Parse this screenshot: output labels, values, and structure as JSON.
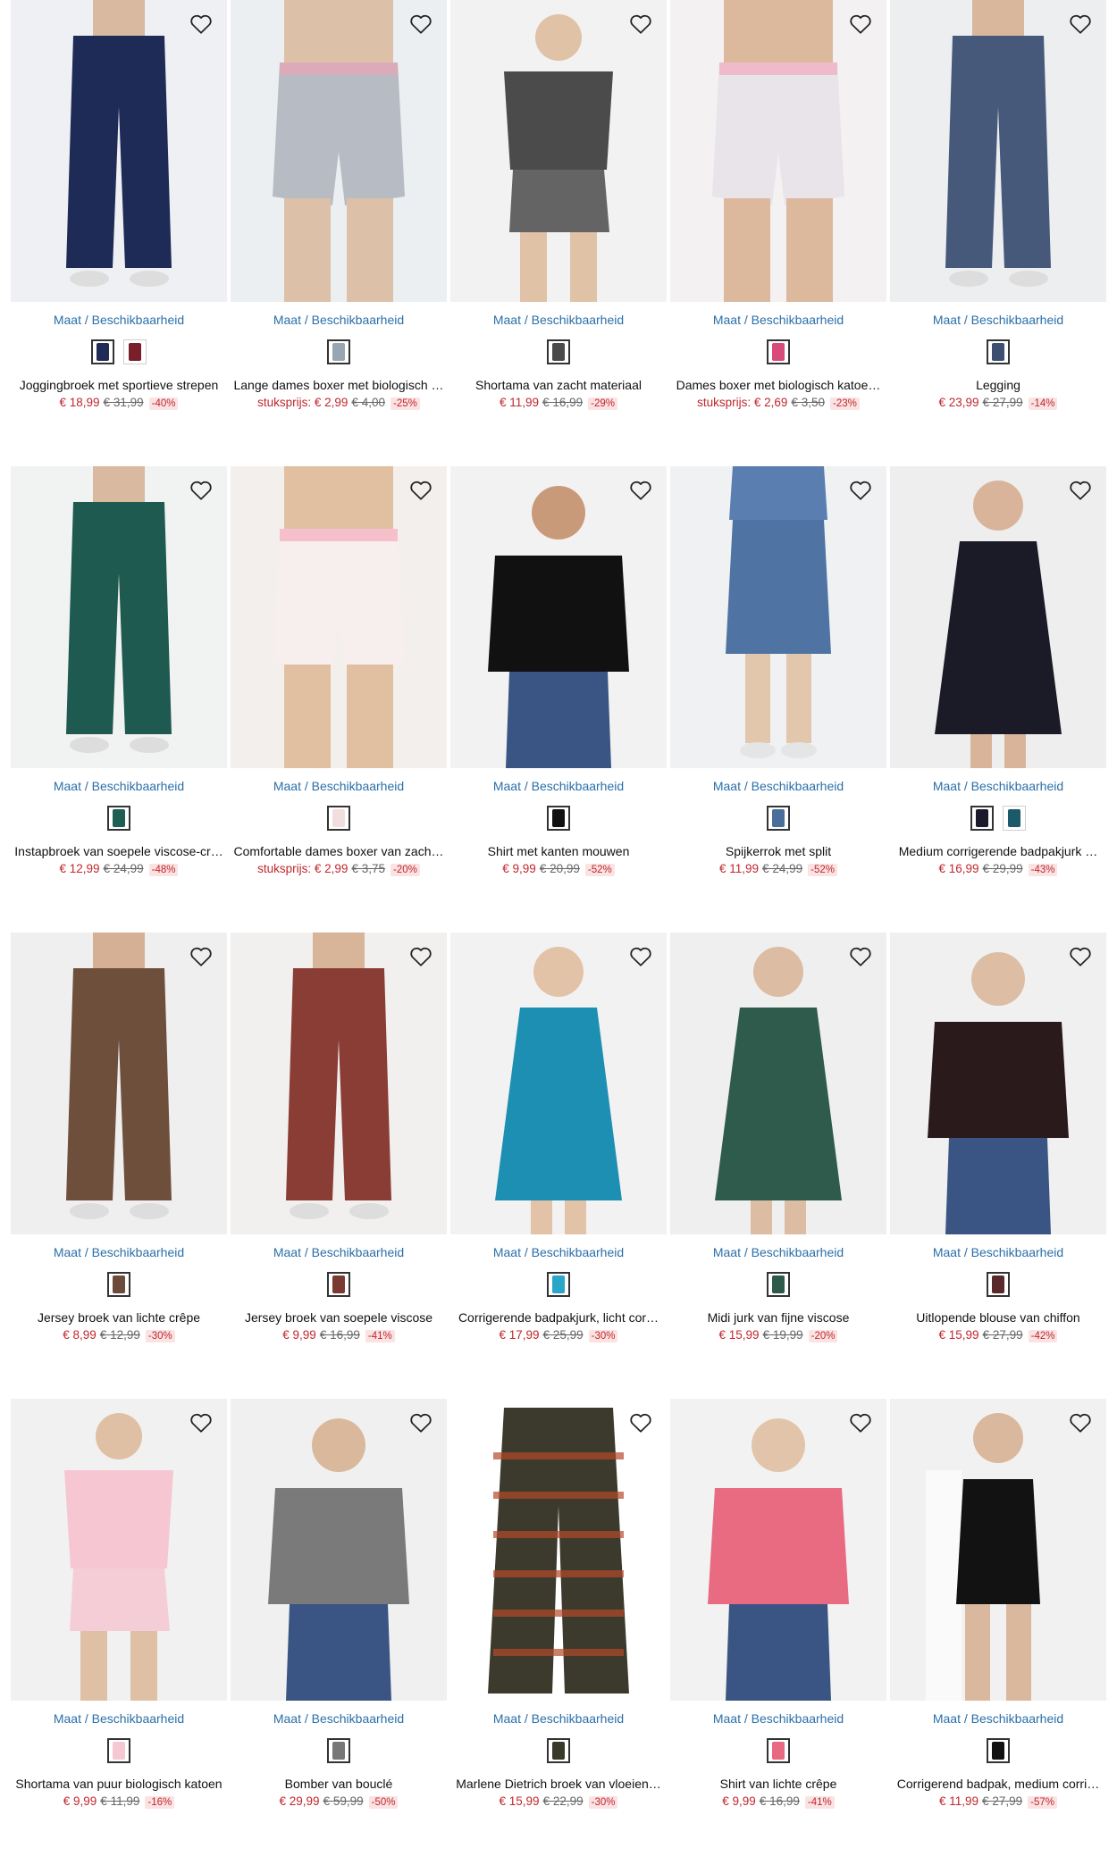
{
  "size_link_label": "Maat / Beschikbaarheid",
  "colors": {
    "price": "#c0272d",
    "link": "#2a6fa8",
    "discount_bg": "#fbe3e3"
  },
  "products": [
    {
      "title": "Joggingbroek met sportieve strepen",
      "price_prefix": "",
      "price": "€ 18,99",
      "old": "€ 31,99",
      "discount": "-40%",
      "icon": "heart-icon",
      "swatches": [
        "#1f2a55",
        "#7a1e2a"
      ],
      "img": {
        "bg": "#eef0f3",
        "garment": "#1e2b57",
        "type": "pants",
        "skin": "#d9b9a0"
      }
    },
    {
      "title": "Lange dames boxer met biologisch …",
      "price_prefix": "stuksprijs: ",
      "price": "€ 2,99",
      "old": "€ 4,00",
      "discount": "-25%",
      "swatches": [
        "#9aa5b4"
      ],
      "img": {
        "bg": "#eceff1",
        "garment": "#b7bcc4",
        "type": "shorts",
        "skin": "#dcc0a8"
      }
    },
    {
      "title": "Shortama van zacht materiaal",
      "price_prefix": "",
      "price": "€ 11,99",
      "old": "€ 16,99",
      "discount": "-29%",
      "swatches": [
        "#4a4a4a"
      ],
      "img": {
        "bg": "#f2f2f2",
        "garment": "#4b4b4b",
        "type": "set",
        "skin": "#e0c2a6"
      }
    },
    {
      "title": "Dames boxer met biologisch katoe…",
      "price_prefix": "stuksprijs: ",
      "price": "€ 2,69",
      "old": "€ 3,50",
      "discount": "-23%",
      "swatches": [
        "#d94a7a"
      ],
      "img": {
        "bg": "#f3f1f1",
        "garment": "#e8e4ea",
        "type": "shorts",
        "skin": "#dcb89c"
      }
    },
    {
      "title": "Legging",
      "price_prefix": "",
      "price": "€ 23,99",
      "old": "€ 27,99",
      "discount": "-14%",
      "swatches": [
        "#3b4f73"
      ],
      "img": {
        "bg": "#eceef0",
        "garment": "#46597a",
        "type": "pants",
        "skin": "#d8b79d"
      }
    },
    {
      "title": "Instapbroek van soepele viscose-cr…",
      "price_prefix": "",
      "price": "€ 12,99",
      "old": "€ 24,99",
      "discount": "-48%",
      "swatches": [
        "#1f5e52"
      ],
      "img": {
        "bg": "#f1f2f2",
        "garment": "#1e5a50",
        "type": "pants",
        "skin": "#d9b9a0"
      }
    },
    {
      "title": "Comfortable dames boxer van zach…",
      "price_prefix": "stuksprijs: ",
      "price": "€ 2,99",
      "old": "€ 3,75",
      "discount": "-20%",
      "swatches": [
        "#f2dede"
      ],
      "img": {
        "bg": "#f3efec",
        "garment": "#f7eeee",
        "type": "shorts",
        "skin": "#e1c0a2"
      }
    },
    {
      "title": "Shirt met kanten mouwen",
      "price_prefix": "",
      "price": "€ 9,99",
      "old": "€ 20,99",
      "discount": "-52%",
      "swatches": [
        "#111111"
      ],
      "img": {
        "bg": "#f2f2f2",
        "garment": "#111111",
        "type": "top",
        "skin": "#c99a7a"
      }
    },
    {
      "title": "Spijkerrok met split",
      "price_prefix": "",
      "price": "€ 11,99",
      "old": "€ 24,99",
      "discount": "-52%",
      "swatches": [
        "#4a6e9c"
      ],
      "img": {
        "bg": "#eff1f3",
        "garment": "#4f73a3",
        "type": "skirt",
        "skin": "#e3c7ad"
      }
    },
    {
      "title": "Medium corrigerende badpakjurk …",
      "price_prefix": "",
      "price": "€ 16,99",
      "old": "€ 29,99",
      "discount": "-43%",
      "swatches": [
        "#1a1a2a",
        "#1b5a6a"
      ],
      "img": {
        "bg": "#eeeeee",
        "garment": "#1b1b28",
        "type": "dress",
        "skin": "#d9b49a"
      }
    },
    {
      "title": "Jersey broek van lichte crêpe",
      "price_prefix": "",
      "price": "€ 8,99",
      "old": "€ 12,99",
      "discount": "-30%",
      "swatches": [
        "#6b4c3a"
      ],
      "img": {
        "bg": "#efefef",
        "garment": "#6e4f3c",
        "type": "pants",
        "skin": "#d6b094"
      }
    },
    {
      "title": "Jersey broek van soepele viscose",
      "price_prefix": "",
      "price": "€ 9,99",
      "old": "€ 16,99",
      "discount": "-41%",
      "swatches": [
        "#7a3a32"
      ],
      "img": {
        "bg": "#f1f0ef",
        "garment": "#8a3d35",
        "type": "pants",
        "skin": "#d8b498"
      }
    },
    {
      "title": "Corrigerende badpakjurk, licht cor…",
      "price_prefix": "",
      "price": "€ 17,99",
      "old": "€ 25,99",
      "discount": "-30%",
      "swatches": [
        "#2aa6c9"
      ],
      "img": {
        "bg": "#f2f2f2",
        "garment": "#1d8fb3",
        "type": "dress",
        "skin": "#e3c3a8"
      }
    },
    {
      "title": "Midi jurk van fijne viscose",
      "price_prefix": "",
      "price": "€ 15,99",
      "old": "€ 19,99",
      "discount": "-20%",
      "swatches": [
        "#2d5a4a"
      ],
      "img": {
        "bg": "#efefef",
        "garment": "#2e5b4b",
        "type": "dress",
        "skin": "#dcbca2"
      }
    },
    {
      "title": "Uitlopende blouse van chiffon",
      "price_prefix": "",
      "price": "€ 15,99",
      "old": "€ 27,99",
      "discount": "-42%",
      "swatches": [
        "#5a2a2a"
      ],
      "img": {
        "bg": "#f0f0f0",
        "garment": "#2a1a1c",
        "type": "top",
        "skin": "#ddbda3"
      }
    },
    {
      "title": "Shortama van puur biologisch katoen",
      "price_prefix": "",
      "price": "€ 9,99",
      "old": "€ 11,99",
      "discount": "-16%",
      "swatches": [
        "#f6c8d4"
      ],
      "img": {
        "bg": "#f1f1f1",
        "garment": "#f6c7d2",
        "type": "set",
        "skin": "#e0c0a4"
      }
    },
    {
      "title": "Bomber van bouclé",
      "price_prefix": "",
      "price": "€ 29,99",
      "old": "€ 59,99",
      "discount": "-50%",
      "swatches": [
        "#777777"
      ],
      "img": {
        "bg": "#f0f0f0",
        "garment": "#7a7a7a",
        "type": "top",
        "skin": "#d9b89c"
      }
    },
    {
      "title": "Marlene Dietrich broek van vloeien…",
      "price_prefix": "",
      "price": "€ 15,99",
      "old": "€ 22,99",
      "discount": "-30%",
      "swatches": [
        "#3a3a2a"
      ],
      "img": {
        "bg": "#ffffff",
        "garment": "#3c3a2c",
        "type": "flat",
        "skin": "#ffffff"
      }
    },
    {
      "title": "Shirt van lichte crêpe",
      "price_prefix": "",
      "price": "€ 9,99",
      "old": "€ 16,99",
      "discount": "-41%",
      "swatches": [
        "#e86a80"
      ],
      "img": {
        "bg": "#f2f2f2",
        "garment": "#e96b82",
        "type": "top",
        "skin": "#e2c4aa"
      }
    },
    {
      "title": "Corrigerend badpak, medium corri…",
      "price_prefix": "",
      "price": "€ 11,99",
      "old": "€ 27,99",
      "discount": "-57%",
      "swatches": [
        "#111111"
      ],
      "img": {
        "bg": "#f1f1f1",
        "garment": "#121212",
        "type": "swim",
        "skin": "#d9b89d"
      }
    }
  ]
}
